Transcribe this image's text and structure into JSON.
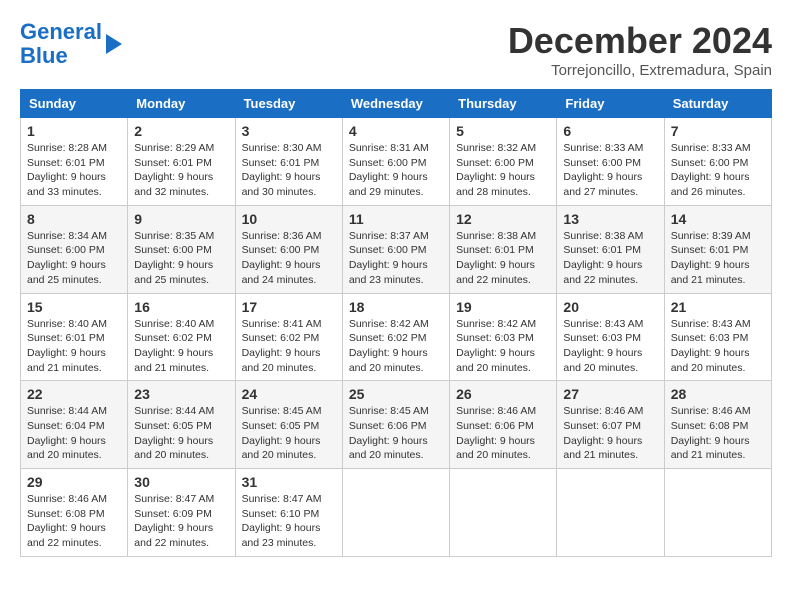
{
  "logo": {
    "line1": "General",
    "line2": "Blue"
  },
  "title": "December 2024",
  "subtitle": "Torrejoncillo, Extremadura, Spain",
  "days_of_week": [
    "Sunday",
    "Monday",
    "Tuesday",
    "Wednesday",
    "Thursday",
    "Friday",
    "Saturday"
  ],
  "weeks": [
    [
      {
        "day": "1",
        "sunrise": "8:28 AM",
        "sunset": "6:01 PM",
        "daylight": "9 hours and 33 minutes."
      },
      {
        "day": "2",
        "sunrise": "8:29 AM",
        "sunset": "6:01 PM",
        "daylight": "9 hours and 32 minutes."
      },
      {
        "day": "3",
        "sunrise": "8:30 AM",
        "sunset": "6:01 PM",
        "daylight": "9 hours and 30 minutes."
      },
      {
        "day": "4",
        "sunrise": "8:31 AM",
        "sunset": "6:00 PM",
        "daylight": "9 hours and 29 minutes."
      },
      {
        "day": "5",
        "sunrise": "8:32 AM",
        "sunset": "6:00 PM",
        "daylight": "9 hours and 28 minutes."
      },
      {
        "day": "6",
        "sunrise": "8:33 AM",
        "sunset": "6:00 PM",
        "daylight": "9 hours and 27 minutes."
      },
      {
        "day": "7",
        "sunrise": "8:33 AM",
        "sunset": "6:00 PM",
        "daylight": "9 hours and 26 minutes."
      }
    ],
    [
      {
        "day": "8",
        "sunrise": "8:34 AM",
        "sunset": "6:00 PM",
        "daylight": "9 hours and 25 minutes."
      },
      {
        "day": "9",
        "sunrise": "8:35 AM",
        "sunset": "6:00 PM",
        "daylight": "9 hours and 25 minutes."
      },
      {
        "day": "10",
        "sunrise": "8:36 AM",
        "sunset": "6:00 PM",
        "daylight": "9 hours and 24 minutes."
      },
      {
        "day": "11",
        "sunrise": "8:37 AM",
        "sunset": "6:00 PM",
        "daylight": "9 hours and 23 minutes."
      },
      {
        "day": "12",
        "sunrise": "8:38 AM",
        "sunset": "6:01 PM",
        "daylight": "9 hours and 22 minutes."
      },
      {
        "day": "13",
        "sunrise": "8:38 AM",
        "sunset": "6:01 PM",
        "daylight": "9 hours and 22 minutes."
      },
      {
        "day": "14",
        "sunrise": "8:39 AM",
        "sunset": "6:01 PM",
        "daylight": "9 hours and 21 minutes."
      }
    ],
    [
      {
        "day": "15",
        "sunrise": "8:40 AM",
        "sunset": "6:01 PM",
        "daylight": "9 hours and 21 minutes."
      },
      {
        "day": "16",
        "sunrise": "8:40 AM",
        "sunset": "6:02 PM",
        "daylight": "9 hours and 21 minutes."
      },
      {
        "day": "17",
        "sunrise": "8:41 AM",
        "sunset": "6:02 PM",
        "daylight": "9 hours and 20 minutes."
      },
      {
        "day": "18",
        "sunrise": "8:42 AM",
        "sunset": "6:02 PM",
        "daylight": "9 hours and 20 minutes."
      },
      {
        "day": "19",
        "sunrise": "8:42 AM",
        "sunset": "6:03 PM",
        "daylight": "9 hours and 20 minutes."
      },
      {
        "day": "20",
        "sunrise": "8:43 AM",
        "sunset": "6:03 PM",
        "daylight": "9 hours and 20 minutes."
      },
      {
        "day": "21",
        "sunrise": "8:43 AM",
        "sunset": "6:03 PM",
        "daylight": "9 hours and 20 minutes."
      }
    ],
    [
      {
        "day": "22",
        "sunrise": "8:44 AM",
        "sunset": "6:04 PM",
        "daylight": "9 hours and 20 minutes."
      },
      {
        "day": "23",
        "sunrise": "8:44 AM",
        "sunset": "6:05 PM",
        "daylight": "9 hours and 20 minutes."
      },
      {
        "day": "24",
        "sunrise": "8:45 AM",
        "sunset": "6:05 PM",
        "daylight": "9 hours and 20 minutes."
      },
      {
        "day": "25",
        "sunrise": "8:45 AM",
        "sunset": "6:06 PM",
        "daylight": "9 hours and 20 minutes."
      },
      {
        "day": "26",
        "sunrise": "8:46 AM",
        "sunset": "6:06 PM",
        "daylight": "9 hours and 20 minutes."
      },
      {
        "day": "27",
        "sunrise": "8:46 AM",
        "sunset": "6:07 PM",
        "daylight": "9 hours and 21 minutes."
      },
      {
        "day": "28",
        "sunrise": "8:46 AM",
        "sunset": "6:08 PM",
        "daylight": "9 hours and 21 minutes."
      }
    ],
    [
      {
        "day": "29",
        "sunrise": "8:46 AM",
        "sunset": "6:08 PM",
        "daylight": "9 hours and 22 minutes."
      },
      {
        "day": "30",
        "sunrise": "8:47 AM",
        "sunset": "6:09 PM",
        "daylight": "9 hours and 22 minutes."
      },
      {
        "day": "31",
        "sunrise": "8:47 AM",
        "sunset": "6:10 PM",
        "daylight": "9 hours and 23 minutes."
      },
      null,
      null,
      null,
      null
    ]
  ]
}
